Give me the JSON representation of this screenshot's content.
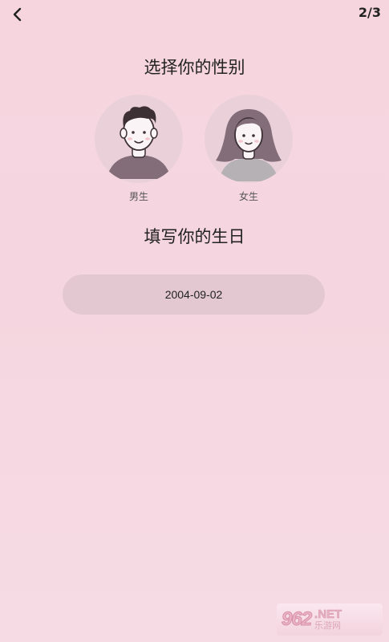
{
  "header": {
    "back_icon": "chevron-left-icon",
    "step": "2/3"
  },
  "gender_section": {
    "title": "选择你的性别",
    "options": [
      {
        "label": "男生",
        "icon": "male-avatar-icon"
      },
      {
        "label": "女生",
        "icon": "female-avatar-icon"
      }
    ]
  },
  "birthday_section": {
    "title": "填写你的生日",
    "date_value": "2004-09-02"
  },
  "watermark": {
    "number": "962",
    "net": ".NET",
    "site": "乐游网"
  },
  "colors": {
    "background": "#f6d5df",
    "avatar_circle": "#ead1d9",
    "date_field": "#e3c8d1",
    "male_shirt": "#836d79",
    "female_hair": "#836d79",
    "female_shirt": "#b6b1b5"
  }
}
